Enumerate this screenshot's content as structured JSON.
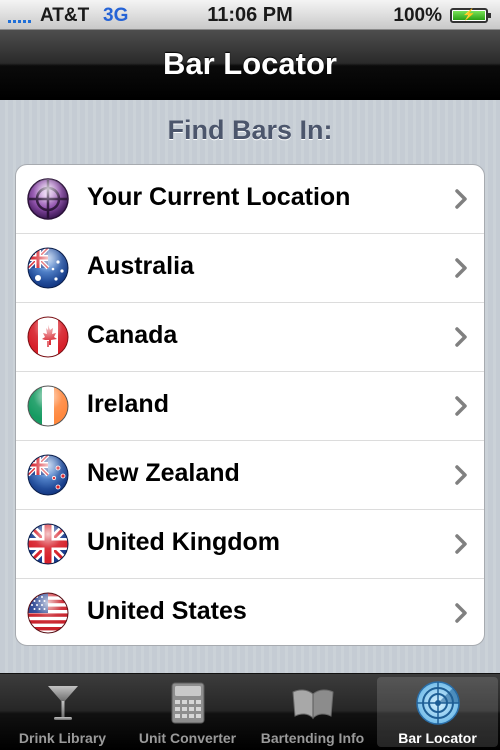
{
  "status_bar": {
    "carrier": "AT&T",
    "network": "3G",
    "time": "11:06 PM",
    "battery_percent": "100%",
    "signal_icon": "signal-bars-icon",
    "battery_icon": "battery-charging-icon"
  },
  "nav_bar": {
    "title": "Bar Locator"
  },
  "section": {
    "header": "Find Bars In:"
  },
  "locations": [
    {
      "label": "Your Current Location",
      "icon": "crosshair-location-icon"
    },
    {
      "label": "Australia",
      "icon": "australia-flag-icon"
    },
    {
      "label": "Canada",
      "icon": "canada-flag-icon"
    },
    {
      "label": "Ireland",
      "icon": "ireland-flag-icon"
    },
    {
      "label": "New Zealand",
      "icon": "new-zealand-flag-icon"
    },
    {
      "label": "United Kingdom",
      "icon": "united-kingdom-flag-icon"
    },
    {
      "label": "United States",
      "icon": "united-states-flag-icon"
    }
  ],
  "tab_bar": {
    "tabs": [
      {
        "label": "Drink Library",
        "icon": "martini-glass-icon",
        "selected": false
      },
      {
        "label": "Unit Converter",
        "icon": "calculator-icon",
        "selected": false
      },
      {
        "label": "Bartending Info",
        "icon": "open-book-icon",
        "selected": false
      },
      {
        "label": "Bar Locator",
        "icon": "radar-icon",
        "selected": true
      }
    ]
  },
  "colors": {
    "nav_bar": "#000000",
    "section_header": "#4c566c",
    "network_3g": "#2563d6",
    "table_background": "#ffffff",
    "tab_label_inactive": "#9a9a9a",
    "tab_label_active": "#ffffff"
  }
}
